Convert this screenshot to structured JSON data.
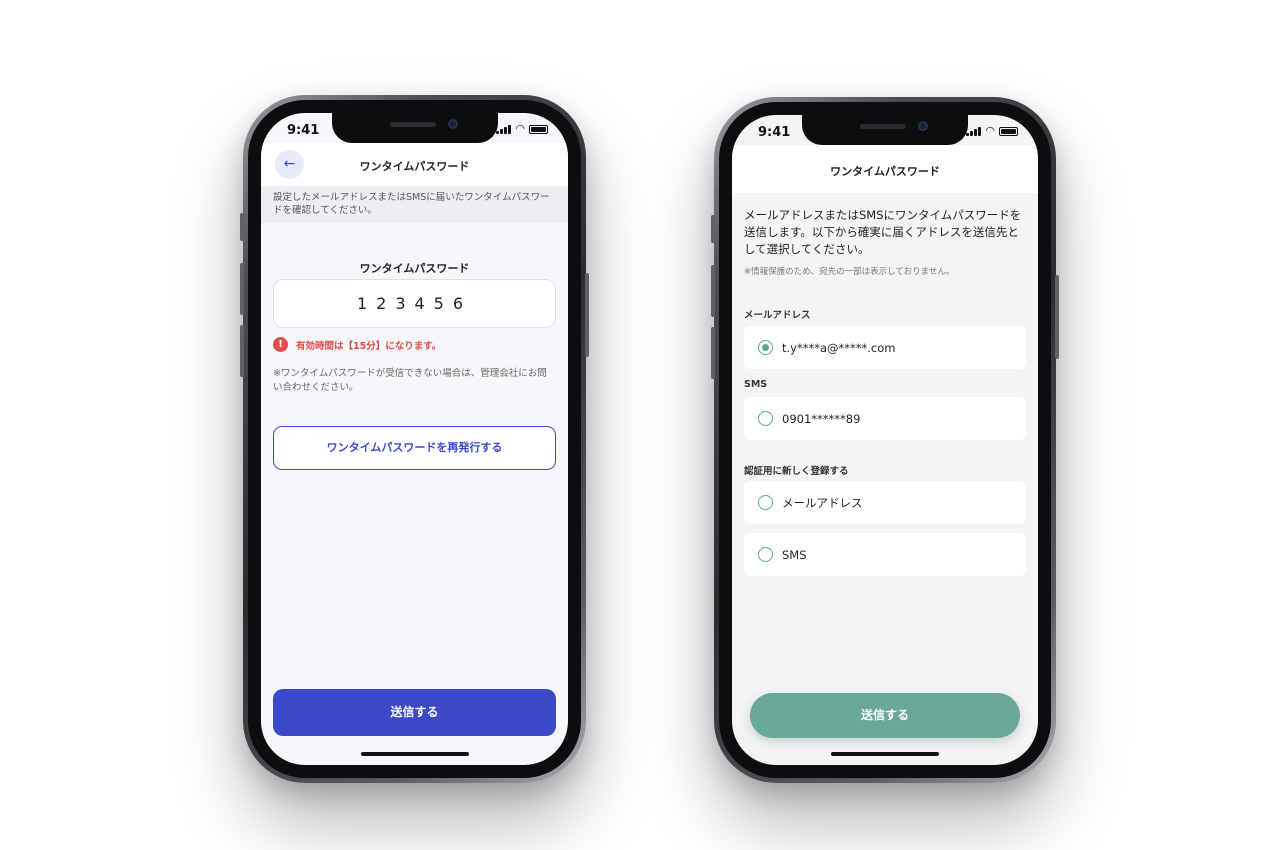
{
  "left_phone": {
    "status_time": "9:41",
    "header": {
      "title": "ワンタイムパスワード",
      "back_icon": "←"
    },
    "notice": "設定したメールアドレスまたはSMSに届いたワンタイムパスワードを確認してください。",
    "otp_label": "ワンタイムパスワード",
    "otp_value": "123456",
    "warning_icon": "!",
    "warning_text": "有効時間は【15分】になります。",
    "note": "※ワンタイムパスワードが受信できない場合は、管理会社にお問い合わせください。",
    "reissue_button": "ワンタイムパスワードを再発行する",
    "submit_button": "送信する"
  },
  "right_phone": {
    "status_time": "9:41",
    "header": {
      "title": "ワンタイムパスワード"
    },
    "intro": "メールアドレスまたはSMSにワンタイムパスワードを送信します。以下から確実に届くアドレスを送信先として選択してください。",
    "sub_note": "※情報保護のため、宛先の一部は表示しておりません。",
    "sections": {
      "email_label": "メールアドレス",
      "email_option": "t.y****a@*****.com",
      "sms_label": "SMS",
      "sms_option": "0901******89",
      "new_label": "認証用に新しく登録する",
      "new_email_option": "メールアドレス",
      "new_sms_option": "SMS"
    },
    "submit_button": "送信する"
  },
  "colors": {
    "left_accent": "#3b49c9",
    "warning": "#e34b4b",
    "right_accent": "#6aa898"
  }
}
